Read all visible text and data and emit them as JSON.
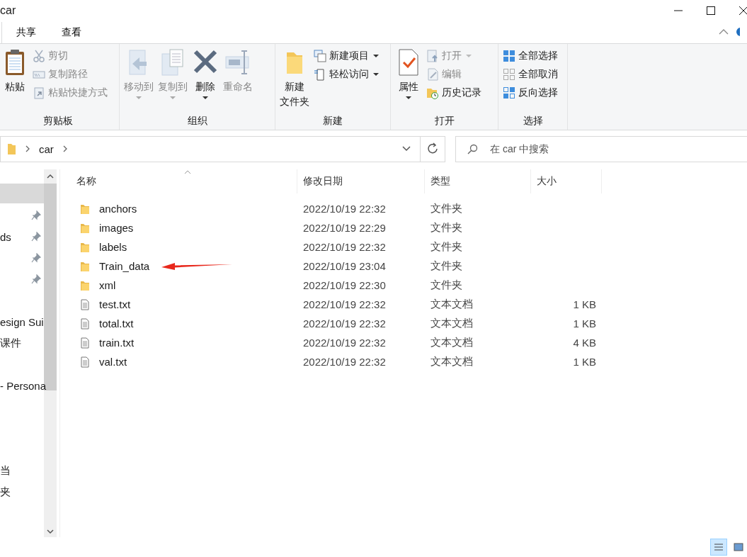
{
  "window": {
    "title": "car"
  },
  "tabs": [
    {
      "label": "共享",
      "selected": false
    },
    {
      "label": "查看",
      "selected": false
    }
  ],
  "ribbon": [
    {
      "label": "剪贴板",
      "items": [
        {
          "kind": "large",
          "lines": [
            "粘贴"
          ],
          "disabled": false,
          "dropdown": false
        },
        {
          "kind": "small",
          "label": "剪切",
          "disabled": true,
          "dropdown": false
        },
        {
          "kind": "small",
          "label": "复制路径",
          "disabled": true,
          "dropdown": false
        },
        {
          "kind": "small",
          "label": "粘贴快捷方式",
          "disabled": true,
          "dropdown": false
        }
      ]
    },
    {
      "label": "组织",
      "items": [
        {
          "kind": "large",
          "lines": [
            "移动到"
          ],
          "disabled": true,
          "dropdown": true
        },
        {
          "kind": "large",
          "lines": [
            "复制到"
          ],
          "disabled": true,
          "dropdown": true
        },
        {
          "kind": "large",
          "lines": [
            "删除"
          ],
          "disabled": false,
          "dropdown": true
        },
        {
          "kind": "large",
          "lines": [
            "重命名"
          ],
          "disabled": true,
          "dropdown": false
        }
      ]
    },
    {
      "label": "新建",
      "items": [
        {
          "kind": "large",
          "lines": [
            "新建",
            "文件夹"
          ],
          "disabled": false,
          "dropdown": false
        },
        {
          "kind": "small",
          "label": "新建项目",
          "disabled": false,
          "dropdown": true
        },
        {
          "kind": "small",
          "label": "轻松访问",
          "disabled": false,
          "dropdown": true
        }
      ]
    },
    {
      "label": "打开",
      "items": [
        {
          "kind": "large",
          "lines": [
            "属性"
          ],
          "disabled": false,
          "dropdown": true
        },
        {
          "kind": "small",
          "label": "打开",
          "disabled": true,
          "dropdown": true
        },
        {
          "kind": "small",
          "label": "编辑",
          "disabled": true,
          "dropdown": false
        },
        {
          "kind": "small",
          "label": "历史记录",
          "disabled": false,
          "dropdown": false
        }
      ]
    },
    {
      "label": "选择",
      "items": [
        {
          "kind": "small",
          "label": "全部选择",
          "disabled": false,
          "dropdown": false
        },
        {
          "kind": "small",
          "label": "全部取消",
          "disabled": false,
          "dropdown": false
        },
        {
          "kind": "small",
          "label": "反向选择",
          "disabled": false,
          "dropdown": false
        }
      ]
    }
  ],
  "address_bar": {
    "path": [
      "car"
    ]
  },
  "search": {
    "placeholder": "在 car 中搜索"
  },
  "nav_pane": [
    {
      "selected": true,
      "pinned": false
    },
    {
      "selected": false,
      "pinned": true
    },
    {
      "label": "ds",
      "selected": false,
      "pinned": true
    },
    {
      "selected": false,
      "pinned": true
    },
    {
      "selected": false,
      "pinned": true
    },
    {
      "selected": false,
      "pinned": false
    },
    {
      "label": "esign Sui",
      "selected": false,
      "pinned": false
    },
    {
      "label": "课件",
      "selected": false,
      "pinned": false
    },
    {
      "selected": false,
      "pinned": false
    },
    {
      "label": "- Persona",
      "selected": false,
      "pinned": false
    },
    {
      "selected": false,
      "pinned": false
    },
    {
      "selected": false,
      "pinned": false
    },
    {
      "selected": false,
      "pinned": false
    },
    {
      "label": "当",
      "selected": false,
      "pinned": false
    },
    {
      "label": "夹",
      "selected": false,
      "pinned": false
    }
  ],
  "table": {
    "columns": [
      "名称",
      "修改日期",
      "类型",
      "大小"
    ],
    "rows": [
      {
        "kind": "folder",
        "name": "anchors",
        "date": "2022/10/19 22:32",
        "type": "文件夹"
      },
      {
        "kind": "folder",
        "name": "images",
        "date": "2022/10/19 22:29",
        "type": "文件夹"
      },
      {
        "kind": "folder",
        "name": "labels",
        "date": "2022/10/19 22:32",
        "type": "文件夹"
      },
      {
        "kind": "folder",
        "name": "Train_data",
        "date": "2022/10/19 23:04",
        "type": "文件夹"
      },
      {
        "kind": "folder",
        "name": "xml",
        "date": "2022/10/19 22:30",
        "type": "文件夹"
      },
      {
        "kind": "file",
        "name": "test.txt",
        "date": "2022/10/19 22:32",
        "type": "文本文档",
        "size": "1 KB"
      },
      {
        "kind": "file",
        "name": "total.txt",
        "date": "2022/10/19 22:32",
        "type": "文本文档",
        "size": "1 KB"
      },
      {
        "kind": "file",
        "name": "train.txt",
        "date": "2022/10/19 22:32",
        "type": "文本文档",
        "size": "4 KB"
      },
      {
        "kind": "file",
        "name": "val.txt",
        "date": "2022/10/19 22:32",
        "type": "文本文档",
        "size": "1 KB"
      }
    ]
  },
  "view_buttons": [
    {
      "selected": true
    },
    {
      "selected": false
    }
  ]
}
